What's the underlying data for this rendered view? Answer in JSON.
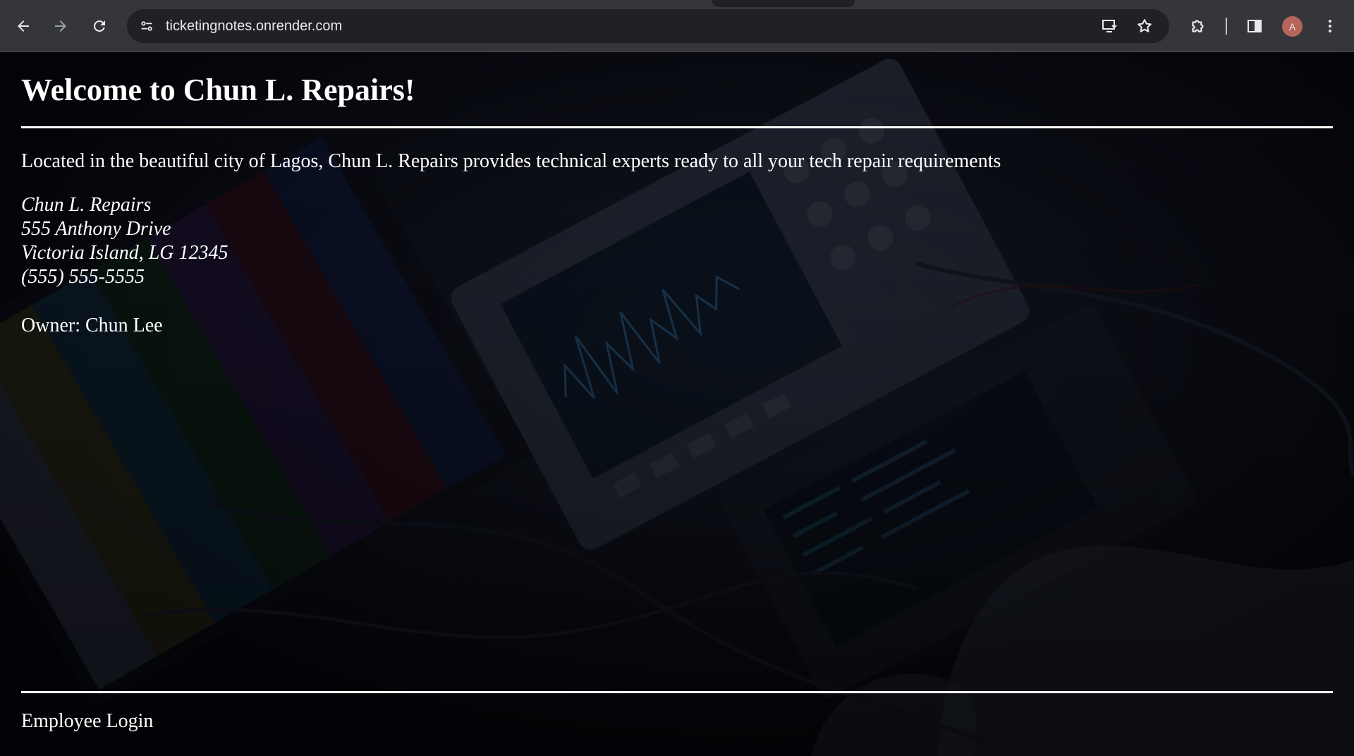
{
  "browser": {
    "url": "ticketingnotes.onrender.com",
    "profile_initial": "A"
  },
  "page": {
    "title": "Welcome to Chun L. Repairs!",
    "intro": "Located in the beautiful city of Lagos, Chun L. Repairs provides technical experts ready to all your tech repair requirements",
    "address": {
      "line1": "Chun L. Repairs",
      "line2": "555 Anthony Drive",
      "line3": "Victoria Island, LG 12345",
      "line4": "(555) 555-5555"
    },
    "owner": "Owner: Chun Lee",
    "footer_link": "Employee Login"
  },
  "colors": {
    "chrome": "#35363a",
    "omnibox": "#202124",
    "page_bg": "#05060c",
    "text": "#ffffff"
  }
}
